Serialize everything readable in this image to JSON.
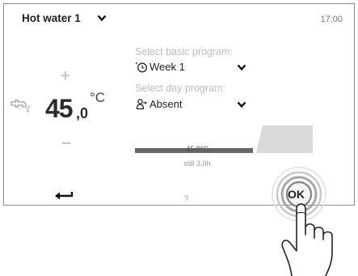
{
  "header": {
    "title": "Hot water 1",
    "time": "17:00"
  },
  "temperature": {
    "integer": "45",
    "decimal": ",0",
    "unit": "°C",
    "increase_symbol": "+",
    "decrease_symbol": "–"
  },
  "program": {
    "basic_label": "Select basic program:",
    "basic_value": "Week 1",
    "day_label": "Select day program:",
    "day_value": "Absent"
  },
  "schedule": {
    "current_temp": "45,0°C",
    "remaining": "still 3,0h",
    "bar_color": "#666666",
    "future_color": "#d9d9d9"
  },
  "nav": {
    "help_label": "?",
    "ok_label": "OK"
  },
  "icons": {
    "back": "back-arrow-icon",
    "tap": "finger-tap-icon",
    "faucet": "faucet-icon",
    "clock": "clock-icon",
    "absent": "person-away-icon"
  }
}
